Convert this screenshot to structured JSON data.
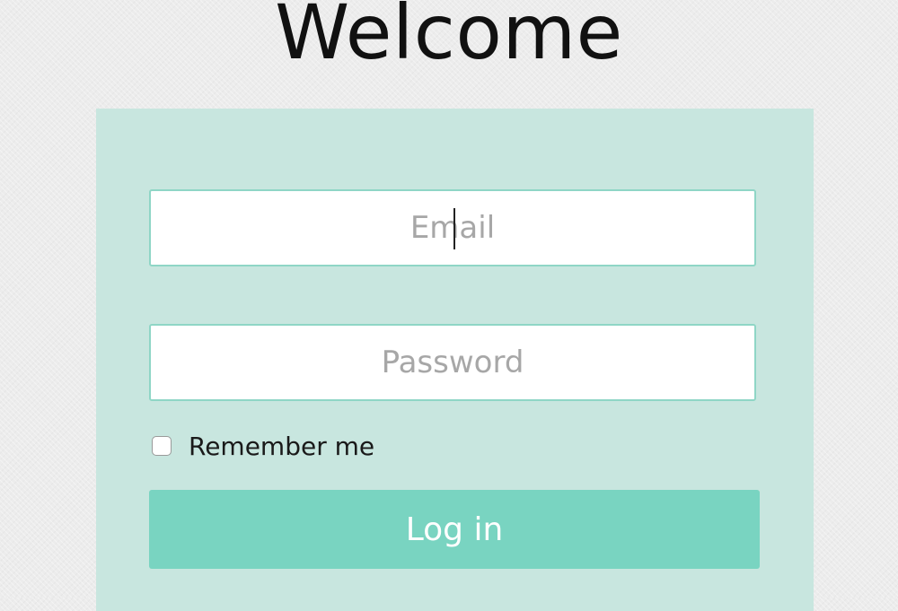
{
  "header": {
    "title": "Welcome"
  },
  "form": {
    "email": {
      "value": "",
      "placeholder": "Email"
    },
    "password": {
      "value": "",
      "placeholder": "Password"
    },
    "remember_me": {
      "label": "Remember me",
      "checked": false
    },
    "login_button_label": "Log in"
  },
  "colors": {
    "panel_background": "#c8e6df",
    "accent": "#79d4c1",
    "field_border": "#8fd6c6",
    "page_background": "#ececec"
  }
}
